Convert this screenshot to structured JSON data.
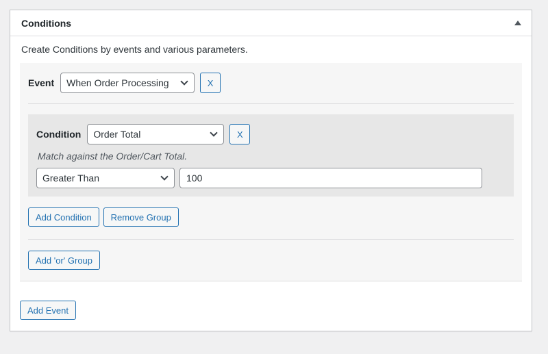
{
  "panel": {
    "title": "Conditions",
    "description": "Create Conditions by events and various parameters.",
    "event": {
      "label": "Event",
      "selected": "When Order Processing",
      "remove_label": "X"
    },
    "condition_group": {
      "label": "Condition",
      "selected": "Order Total",
      "remove_label": "X",
      "help_text": "Match against the Order/Cart Total.",
      "operator_selected": "Greater Than",
      "value": "100"
    },
    "actions": {
      "add_condition": "Add Condition",
      "remove_group": "Remove Group",
      "add_or_group": "Add 'or' Group",
      "add_event": "Add Event"
    }
  },
  "icons": {
    "collapse_toggle": "triangle-up",
    "select_arrow": "chevron-down"
  },
  "colors": {
    "page_bg": "#f0f0f1",
    "panel_bg": "#ffffff",
    "panel_border": "#c3c4c7",
    "event_block_bg": "#f6f6f6",
    "condition_group_bg": "#e7e7e7",
    "accent_blue": "#2271b1",
    "input_border": "#8c8f94",
    "text": "#1d2327",
    "muted_text": "#50575e"
  }
}
